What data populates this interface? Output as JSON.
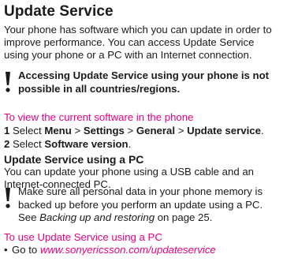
{
  "title": "Update Service",
  "intro": "Your phone has software which you can update in order to\nimprove performance. You can access Update Service\nusing your phone or a PC with an Internet connection.",
  "note1": "Accessing Update Service using your phone is not\npossible in all countries/regions.",
  "sub1": "To view the current software in the phone",
  "steps": {
    "s1_num": "1",
    "s1_pre": "Select",
    "s1_menu": "Menu",
    "s1_sep1": ">",
    "s1_settings": "Settings",
    "s1_sep2": ">",
    "s1_general": "General",
    "s1_sep3": ">",
    "s1_update": "Update service",
    "s1_end": ".",
    "s2_num": "2",
    "s2_pre": "Select",
    "s2_sw": "Software version",
    "s2_end": "."
  },
  "heading2": "Update Service using a PC",
  "para2": "You can update your phone using a USB cable and an\nInternet-connected PC.",
  "note2": {
    "line1": "Make sure all personal data in your phone memory is",
    "line2": "backed up before you perform an update using a PC.",
    "see": "See",
    "ref": "Backing up and restoring",
    "tail": "on page 25."
  },
  "sub2": "To use Update Service using a PC",
  "bullet": {
    "dot": "•",
    "pre": "Go to",
    "link": "www.sonyericsson.com/updateservice"
  },
  "colors": {
    "accent": "#e5007e",
    "text": "#1a1a1a"
  }
}
